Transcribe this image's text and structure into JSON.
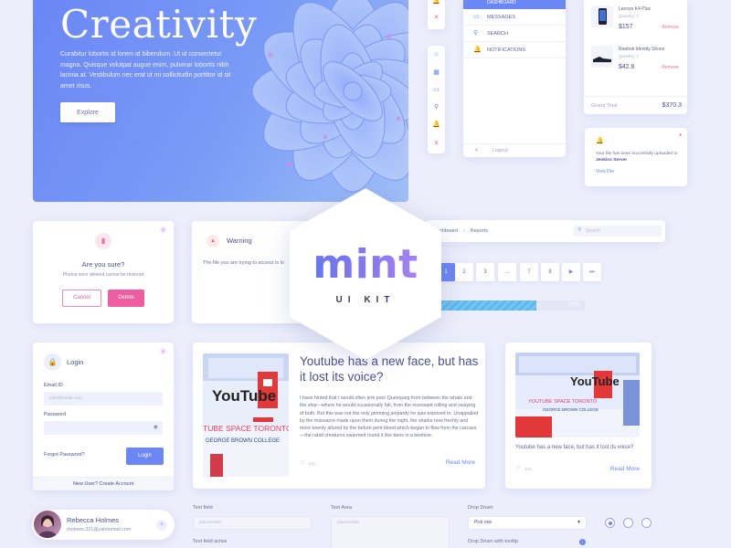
{
  "hero": {
    "title": "Creativity",
    "body": "Curabitur lobortis id lorem id bibendum. Ut id consectetur magna. Quisque volutpat augue enim, pulvinar lobortis nibh lacinia at. Vestibulum nec erat ut mi sollicitudin porttitor id sit amet risus.",
    "button": "Explore"
  },
  "menu": {
    "active": "DASHBOARD",
    "items": [
      "MESSAGES",
      "SEARCH",
      "NOTIFICATIONS"
    ],
    "logout": "Logout"
  },
  "cart": {
    "products": [
      {
        "name": "Lenovo K4 Plus",
        "qty": "Quantity: 2",
        "price": "$157",
        "remove": "Remove"
      },
      {
        "name": "Reebok Identity Shoes",
        "qty": "Quantity: 1",
        "price": "$42.8",
        "remove": "Remove"
      }
    ],
    "total_label": "Grand Total",
    "total_value": "$370.3"
  },
  "notification": {
    "text": "Your file has been succesfully uploaded to",
    "target": "Jenkins Server",
    "link": "View File"
  },
  "confirm": {
    "title": "Are you sure?",
    "message": "Photos once deleted cannot be restored",
    "cancel": "Cancel",
    "delete": "Delete"
  },
  "warning": {
    "title": "Warning",
    "message": "The file you are trying to access is lo"
  },
  "breadcrumb": {
    "items": [
      "ashboard",
      "Reports"
    ],
    "search_placeholder": "Search"
  },
  "pagination": {
    "pages": [
      "1",
      "2",
      "3",
      "...",
      "7",
      "8"
    ],
    "next": "▶",
    "last": "⏭"
  },
  "progress": {
    "value": 0.67,
    "label": "67%"
  },
  "login": {
    "title": "Login",
    "email_label": "Email ID",
    "email_placeholder": "john@email.com",
    "password_label": "Password",
    "forgot": "Forgot Password?",
    "button": "Login",
    "new_user": "New User? Create Account"
  },
  "article": {
    "title": "Youtube has a new face, but has it lost its voice?",
    "body": "I have hinted that I would often jerk poor Queequeg from between the whale and the ship—where he would occasionally fall, from the incessant rolling and swaying of both. But this was not the only jamming jeopardy he was exposed to. Unappalled by the massacre made upon them during the night, the sharks now freshly and more keenly allured by the before pent blood which began to flow from the carcass—the rabid creatures swarmed round it like bees in a beehive.",
    "likes": "141",
    "read_more": "Read More",
    "img_logo": "YouTube",
    "img_sign": "TUBE SPACE TORONTO",
    "img_college": "GEORGE BROWN COLLEGE"
  },
  "article_small": {
    "title": "Youtube has a new face, but has it lost its voice?",
    "likes": "141",
    "read_more": "Read More",
    "img_logo": "YouTube",
    "img_sign": "YOUTUBE SPACE TORONTO",
    "img_college": "GEORGE BROWN COLLEGE"
  },
  "profile": {
    "name": "Rebecca Holmes",
    "email": "rholmes.321@yahoomail.com"
  },
  "forms": {
    "text_field_label": "Text field",
    "text_field_placeholder": "placeholder",
    "text_field_active_label": "Text field active",
    "text_area_label": "Text Area",
    "text_area_placeholder": "placeholder",
    "dropdown_label": "Drop Down",
    "dropdown_value": "Pick one",
    "dropdown_tooltip_label": "Drop Down with tooltip"
  },
  "brand": {
    "logo": "mint",
    "subtitle": "UI KIT"
  },
  "colors": {
    "accent": "#6b86f5",
    "pink": "#ef5da1",
    "background": "#eceefb"
  }
}
